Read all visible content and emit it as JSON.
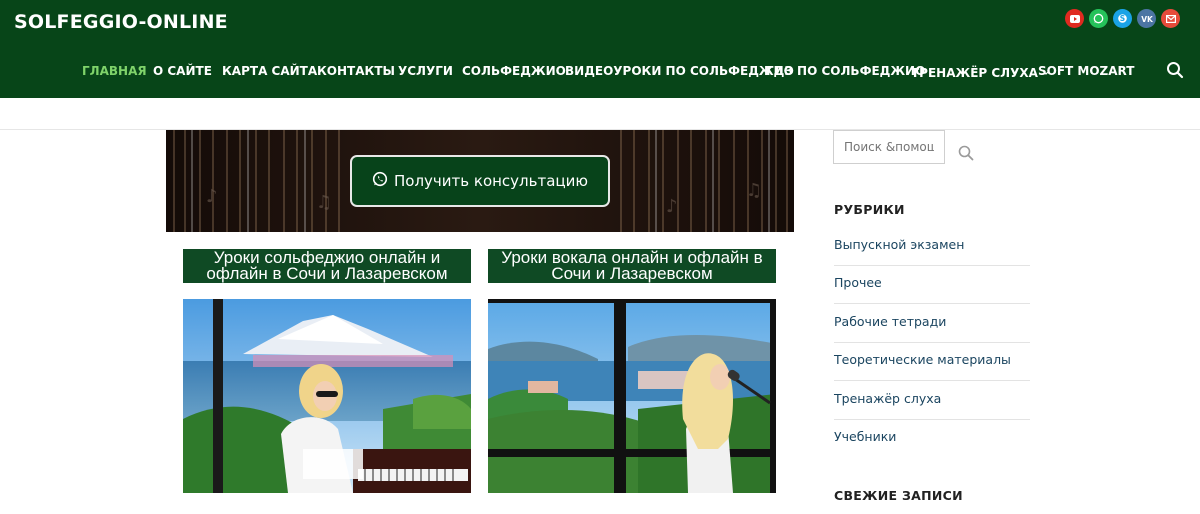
{
  "site": {
    "title": "SOLFEGGIO-ONLINE"
  },
  "social": [
    {
      "name": "youtube-icon",
      "color": "#e02a20"
    },
    {
      "name": "whatsapp-icon",
      "color": "#25c25a"
    },
    {
      "name": "skype-icon",
      "color": "#1aa3e6"
    },
    {
      "name": "vk-icon",
      "color": "#4c75a3"
    },
    {
      "name": "email-icon",
      "color": "#e64b3b"
    }
  ],
  "nav": {
    "items": [
      {
        "label": "ГЛАВНАЯ",
        "active": true
      },
      {
        "label": "О САЙТЕ"
      },
      {
        "label": "КАРТА САЙТА"
      },
      {
        "label": "КОНТАКТЫ"
      },
      {
        "label": "УСЛУГИ"
      },
      {
        "label": "СОЛЬФЕДЖИО"
      },
      {
        "label": "ВИДЕОУРОКИ ПО СОЛЬФЕДЖИО"
      },
      {
        "label": "ГДЗ ПО СОЛЬФЕДЖИО"
      },
      {
        "label": "ТРЕНАЖЁР СЛУХА",
        "has_dropdown": true
      },
      {
        "label": "SOFT MOZART"
      }
    ],
    "active_color": "#7fd36a",
    "header_color": "#074518"
  },
  "banner": {
    "button_label": "Получить консультацию",
    "button_icon": "whatsapp-icon"
  },
  "cards": [
    {
      "title_line1": "Уроки сольфеджио онлайн и",
      "title_line2": "офлайн в Сочи и Лазаревском"
    },
    {
      "title_line1": "Уроки вокала онлайн и офлайн в",
      "title_line2": "Сочи и Лазаревском"
    }
  ],
  "sidebar": {
    "search_placeholder": "Поиск &помощь",
    "categories_heading": "РУБРИКИ",
    "categories": [
      "Выпускной экзамен",
      "Прочее",
      "Рабочие тетради",
      "Теоретические материалы",
      "Тренажёр слуха",
      "Учебники"
    ],
    "recent_heading": "СВЕЖИЕ ЗАПИСИ"
  }
}
